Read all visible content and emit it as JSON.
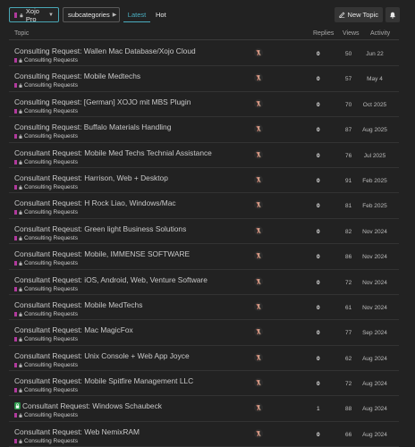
{
  "colors": {
    "category": "#b03a9c",
    "background": "#222222",
    "accent": "#4aaec0",
    "lock_badge": "#2e9e4f"
  },
  "nav": {
    "category_label": "Xojo Pro",
    "subcategory_label": "subcategories",
    "latest_label": "Latest",
    "hot_label": "Hot",
    "new_topic_label": "New Topic",
    "new_topic_icon": "pencil-icon",
    "bell_icon": "bell-icon"
  },
  "table": {
    "headers": {
      "topic": "Topic",
      "replies": "Replies",
      "views": "Views",
      "activity": "Activity"
    },
    "category_name": "Consulting Requests",
    "rows": [
      {
        "title": "Consulting Request: Wallen Mac Database/Xojo Cloud",
        "replies": "0",
        "views": "50",
        "activity": "Jun 22"
      },
      {
        "title": "Consulting Request: Mobile Medtechs",
        "replies": "0",
        "views": "57",
        "activity": "May 4"
      },
      {
        "title": "Consulting Request: [German] XOJO mit MBS Plugin",
        "replies": "0",
        "views": "70",
        "activity": "Oct 2025"
      },
      {
        "title": "Consulting Request: Buffalo Materials Handling",
        "replies": "0",
        "views": "87",
        "activity": "Aug 2025"
      },
      {
        "title": "Consultant Request: Mobile Med Techs Technial Assistance",
        "replies": "0",
        "views": "76",
        "activity": "Jul 2025"
      },
      {
        "title": "Consultant Request: Harrison, Web + Desktop",
        "replies": "0",
        "views": "91",
        "activity": "Feb 2025"
      },
      {
        "title": "Consultant Request: H Rock Liao, Windows/Mac",
        "replies": "0",
        "views": "81",
        "activity": "Feb 2025"
      },
      {
        "title": "Consultant Reqeust: Green light Business Solutions",
        "replies": "0",
        "views": "82",
        "activity": "Nov 2024"
      },
      {
        "title": "Consultant Request: Mobile, IMMENSE SOFTWARE",
        "replies": "0",
        "views": "86",
        "activity": "Nov 2024"
      },
      {
        "title": "Consultant Request: iOS, Android, Web, Venture Software",
        "replies": "0",
        "views": "72",
        "activity": "Nov 2024"
      },
      {
        "title": "Consultant Request: Mobile MedTechs",
        "replies": "0",
        "views": "61",
        "activity": "Nov 2024"
      },
      {
        "title": "Consultant Request: Mac MagicFox",
        "replies": "0",
        "views": "77",
        "activity": "Sep 2024"
      },
      {
        "title": "Consultant Request: Unix Console + Web App Joyce",
        "replies": "0",
        "views": "62",
        "activity": "Aug 2024"
      },
      {
        "title": "Consultant Request: Mobile Spitfire Management LLC",
        "replies": "0",
        "views": "72",
        "activity": "Aug 2024"
      },
      {
        "title": "Consultant Request: Windows Schaubeck",
        "replies": "1",
        "views": "88",
        "activity": "Aug 2024",
        "locked": true
      },
      {
        "title": "Consultant Request: Web NemixRAM",
        "replies": "0",
        "views": "66",
        "activity": "Aug 2024"
      }
    ]
  }
}
